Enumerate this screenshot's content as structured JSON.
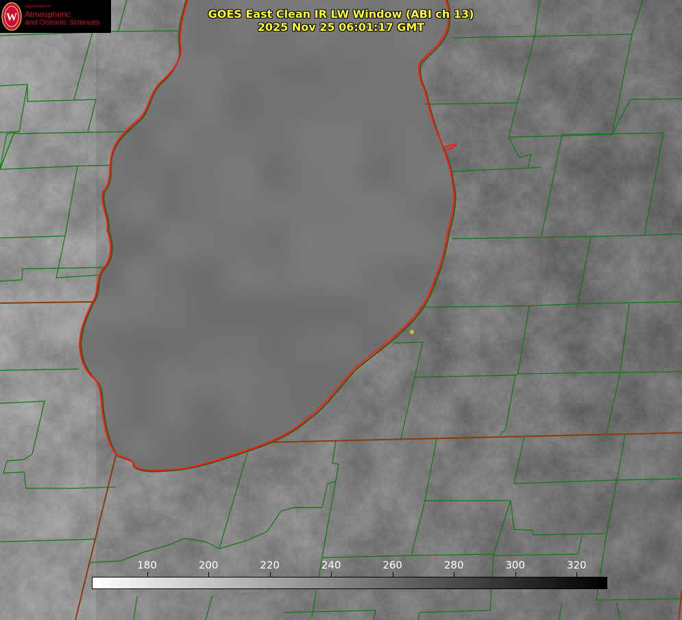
{
  "title": {
    "line1": "GOES East Clean IR LW Window (ABI ch 13)",
    "line2": "2025 Nov 25 06:01:17 GMT"
  },
  "logo": {
    "dept": "Department of",
    "line1": "Atmospheric",
    "line2": "and Oceanic Sciences",
    "seal_letter": "W",
    "color": "#c8102e"
  },
  "colorbar": {
    "ticks": [
      "180",
      "200",
      "220",
      "240",
      "260",
      "280",
      "300",
      "320"
    ],
    "tick_values": [
      180,
      200,
      220,
      240,
      260,
      280,
      300,
      320
    ],
    "range": [
      162,
      330
    ],
    "gradient_colors": [
      "#ffffff",
      "#000000"
    ]
  },
  "colors": {
    "county_lines": "#006400",
    "state_lines": "#8b3a0f",
    "lake_outline": "#ff1a1a",
    "title_text": "#ffff33",
    "marker": "#d4c21a"
  }
}
